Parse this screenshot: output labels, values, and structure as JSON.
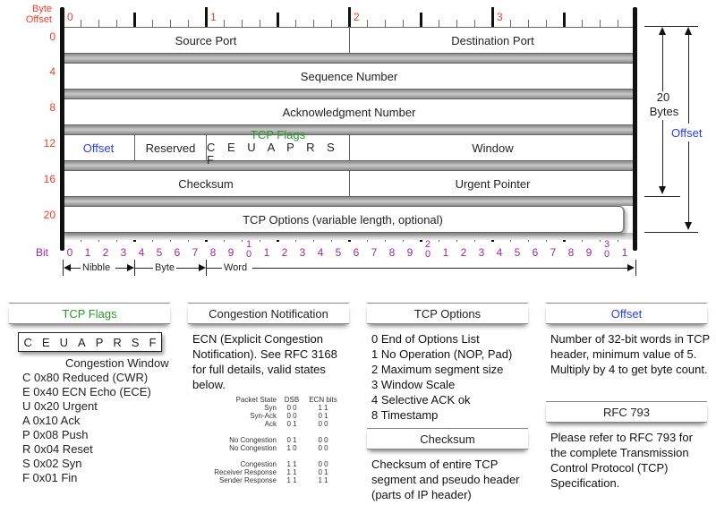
{
  "diagram": {
    "byte_offset_label": [
      "Byte",
      "Offset"
    ],
    "top_byte_numbers": [
      "0",
      "1",
      "2",
      "3"
    ],
    "row_offsets": [
      "0",
      "4",
      "8",
      "12",
      "16",
      "20"
    ],
    "rows": [
      {
        "fields": [
          "Source Port",
          "Destination Port"
        ]
      },
      {
        "fields": [
          "Sequence Number"
        ]
      },
      {
        "fields": [
          "Acknowledgment Number"
        ]
      },
      {
        "fields": [
          "Offset",
          "Reserved",
          "TCP Flags",
          "Window"
        ],
        "flags_letters": "C E U A P R S F"
      },
      {
        "fields": [
          "Checksum",
          "Urgent Pointer"
        ]
      },
      {
        "fields": [
          "TCP Options (variable length, optional)"
        ]
      }
    ],
    "bit_label": "Bit",
    "bit_numbers": [
      "0",
      "1",
      "2",
      "3",
      "4",
      "5",
      "6",
      "7",
      "8",
      "9",
      "10",
      "1",
      "2",
      "3",
      "4",
      "5",
      "6",
      "7",
      "8",
      "9",
      "20",
      "1",
      "2",
      "3",
      "4",
      "5",
      "6",
      "7",
      "8",
      "9",
      "30",
      "1"
    ],
    "scale_labels": {
      "nibble": "Nibble",
      "byte": "Byte",
      "word": "Word"
    },
    "right_annotations": {
      "twenty": "20",
      "bytes": "Bytes",
      "offset": "Offset"
    }
  },
  "colors": {
    "offset_red": "#e8402a",
    "offset_blue": "#2a3ee8",
    "flags_green": "#2a9a2a",
    "bits_purple": "#9a2a9a"
  },
  "legend": {
    "tcp_flags": {
      "title": "TCP Flags",
      "letters": [
        "C",
        "E",
        "U",
        "A",
        "P",
        "R",
        "S",
        "F"
      ],
      "subtitle": "Congestion Window",
      "items": [
        {
          "letter": "C",
          "hex": "0x80",
          "name": "Reduced (CWR)"
        },
        {
          "letter": "E",
          "hex": "0x40",
          "name": "ECN Echo (ECE)"
        },
        {
          "letter": "U",
          "hex": "0x20",
          "name": "Urgent"
        },
        {
          "letter": "A",
          "hex": "0x10",
          "name": "Ack"
        },
        {
          "letter": "P",
          "hex": "0x08",
          "name": "Push"
        },
        {
          "letter": "R",
          "hex": "0x04",
          "name": "Reset"
        },
        {
          "letter": "S",
          "hex": "0x02",
          "name": "Syn"
        },
        {
          "letter": "F",
          "hex": "0x01",
          "name": "Fin"
        }
      ]
    },
    "congestion": {
      "title": "Congestion Notification",
      "text": "ECN (Explicit Congestion Notification).  See RFC 3168 for full details, valid states below.",
      "table_headers": [
        "Packet State",
        "DSB",
        "ECN bits"
      ],
      "rows": [
        [
          "Syn",
          "0 0",
          "1 1"
        ],
        [
          "Syn-Ack",
          "0 0",
          "0 1"
        ],
        [
          "Ack",
          "0 1",
          "0 0"
        ],
        null,
        [
          "No Congestion",
          "0 1",
          "0 0"
        ],
        [
          "No Congestion",
          "1 0",
          "0 0"
        ],
        null,
        [
          "Congestion",
          "1 1",
          "0 0"
        ],
        [
          "Receiver Response",
          "1 1",
          "0 1"
        ],
        [
          "Sender Response",
          "1 1",
          "1 1"
        ]
      ]
    },
    "tcp_options": {
      "title": "TCP Options",
      "items": [
        "0 End of Options List",
        "1 No Operation (NOP, Pad)",
        "2 Maximum segment size",
        "3 Window Scale",
        "4 Selective ACK ok",
        "8 Timestamp"
      ]
    },
    "checksum": {
      "title": "Checksum",
      "text": "Checksum of entire TCP segment and pseudo header (parts of IP header)"
    },
    "offset": {
      "title": "Offset",
      "text": "Number of 32-bit words in TCP header, minimum value of 5.  Multiply by 4 to get byte count."
    },
    "rfc": {
      "title": "RFC 793",
      "text": "Please refer to RFC 793 for the complete Transmission Control Protocol (TCP) Specification."
    }
  }
}
